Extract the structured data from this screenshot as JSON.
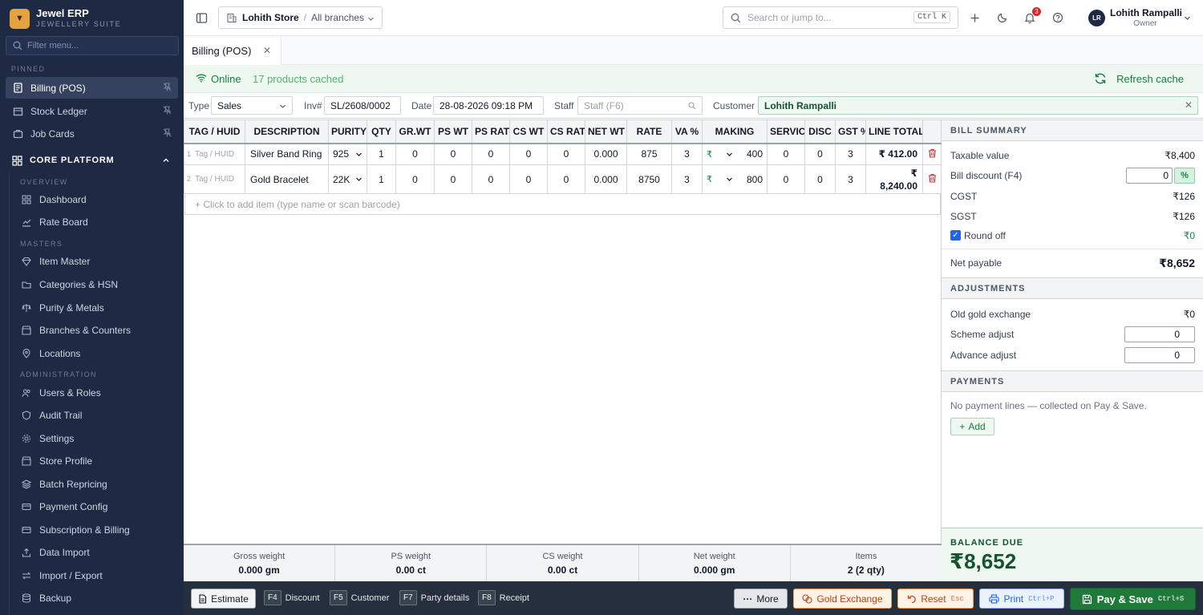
{
  "brand": {
    "name": "Jewel ERP",
    "subtitle": "JEWELLERY SUITE"
  },
  "sidebar": {
    "filter_placeholder": "Filter menu...",
    "pinned_label": "PINNED",
    "pinned": [
      {
        "label": "Billing (POS)",
        "active": true
      },
      {
        "label": "Stock Ledger"
      },
      {
        "label": "Job Cards"
      }
    ],
    "core_label": "CORE PLATFORM",
    "overview_label": "OVERVIEW",
    "overview": [
      {
        "label": "Dashboard"
      },
      {
        "label": "Rate Board"
      }
    ],
    "masters_label": "MASTERS",
    "masters": [
      {
        "label": "Item Master"
      },
      {
        "label": "Categories & HSN"
      },
      {
        "label": "Purity & Metals"
      },
      {
        "label": "Branches & Counters"
      },
      {
        "label": "Locations"
      }
    ],
    "admin_label": "ADMINISTRATION",
    "admin": [
      {
        "label": "Users & Roles"
      },
      {
        "label": "Audit Trail"
      },
      {
        "label": "Settings"
      },
      {
        "label": "Store Profile"
      },
      {
        "label": "Batch Repricing"
      },
      {
        "label": "Payment Config"
      },
      {
        "label": "Subscription & Billing"
      },
      {
        "label": "Data Import"
      },
      {
        "label": "Import / Export"
      },
      {
        "label": "Backup"
      }
    ]
  },
  "header": {
    "store": "Lohith Store",
    "branch": "All branches",
    "search_placeholder": "Search or jump to...",
    "search_shortcut": "Ctrl K",
    "notifications": "3",
    "user_initials": "LR",
    "user_name": "Lohith Rampalli",
    "user_role": "Owner"
  },
  "tab": {
    "label": "Billing (POS)"
  },
  "status": {
    "online": "Online",
    "cached": "17 products cached",
    "refresh": "Refresh cache"
  },
  "form": {
    "type_label": "Type",
    "type_value": "Sales",
    "inv_label": "Inv#",
    "inv_value": "SL/2608/0002",
    "date_label": "Date",
    "date_value": "28-08-2026 09:18 PM",
    "staff_label": "Staff",
    "staff_placeholder": "Staff (F6)",
    "customer_label": "Customer",
    "customer_value": "Lohith Rampalli"
  },
  "table": {
    "columns": [
      "TAG / HUID",
      "DESCRIPTION",
      "PURITY",
      "QTY",
      "GR.WT",
      "PS WT",
      "PS RATE",
      "CS WT",
      "CS RATE",
      "NET WT",
      "RATE",
      "VA %",
      "MAKING",
      "SERVICE",
      "DISC",
      "GST %",
      "LINE TOTAL"
    ],
    "rows": [
      {
        "num": "1",
        "tag": "Tag / HUID",
        "desc": "Silver Band Ring",
        "purity": "925",
        "qty": "1",
        "grwt": "0",
        "pswt": "0",
        "psrate": "0",
        "cswt": "0",
        "csrate": "0",
        "netwt": "0.000",
        "rate": "875",
        "va": "3",
        "making_sym": "₹",
        "making": "400",
        "service": "0",
        "disc": "0",
        "gst": "3",
        "total": "₹ 412.00"
      },
      {
        "num": "2",
        "tag": "Tag / HUID",
        "desc": "Gold Bracelet",
        "purity": "22K",
        "qty": "1",
        "grwt": "0",
        "pswt": "0",
        "psrate": "0",
        "cswt": "0",
        "csrate": "0",
        "netwt": "0.000",
        "rate": "8750",
        "va": "3",
        "making_sym": "₹",
        "making": "800",
        "service": "0",
        "disc": "0",
        "gst": "3",
        "total_sym": "₹",
        "total": "8,240.00"
      }
    ],
    "add_hint": "+ Click to add item (type name or scan barcode)"
  },
  "totals": [
    {
      "label": "Gross weight",
      "value": "0.000 gm"
    },
    {
      "label": "PS weight",
      "value": "0.00 ct"
    },
    {
      "label": "CS weight",
      "value": "0.00 ct"
    },
    {
      "label": "Net weight",
      "value": "0.000 gm"
    },
    {
      "label": "Items",
      "value": "2 (2 qty)"
    }
  ],
  "summary": {
    "title": "BILL SUMMARY",
    "taxable_label": "Taxable value",
    "taxable": "₹8,400",
    "discount_label": "Bill discount (F4)",
    "discount": "0",
    "discount_mode": "%",
    "cgst_label": "CGST",
    "cgst": "₹126",
    "sgst_label": "SGST",
    "sgst": "₹126",
    "round_label": "Round off",
    "round": "₹0",
    "net_label": "Net payable",
    "net": "₹8,652",
    "adj_title": "ADJUSTMENTS",
    "oldgold_label": "Old gold exchange",
    "oldgold": "₹0",
    "scheme_label": "Scheme adjust",
    "scheme": "0",
    "advance_label": "Advance adjust",
    "advance": "0",
    "pay_title": "PAYMENTS",
    "pay_empty": "No payment lines — collected on Pay & Save.",
    "add_label": "Add",
    "balance_label": "BALANCE DUE",
    "balance": "₹8,652"
  },
  "footer": {
    "estimate": "Estimate",
    "keys": [
      {
        "key": "F4",
        "label": "Discount"
      },
      {
        "key": "F5",
        "label": "Customer"
      },
      {
        "key": "F7",
        "label": "Party details"
      },
      {
        "key": "F8",
        "label": "Receipt"
      }
    ],
    "more": "More",
    "gold": "Gold Exchange",
    "reset": "Reset",
    "reset_key": "Esc",
    "print": "Print",
    "print_key": "Ctrl+P",
    "pay": "Pay & Save",
    "pay_key": "Ctrl+S"
  },
  "colors": {
    "sidebar": "#1e2a44",
    "accent_green": "#1f7a3a",
    "accent_orange": "#c2410c",
    "accent_blue": "#2563eb"
  }
}
